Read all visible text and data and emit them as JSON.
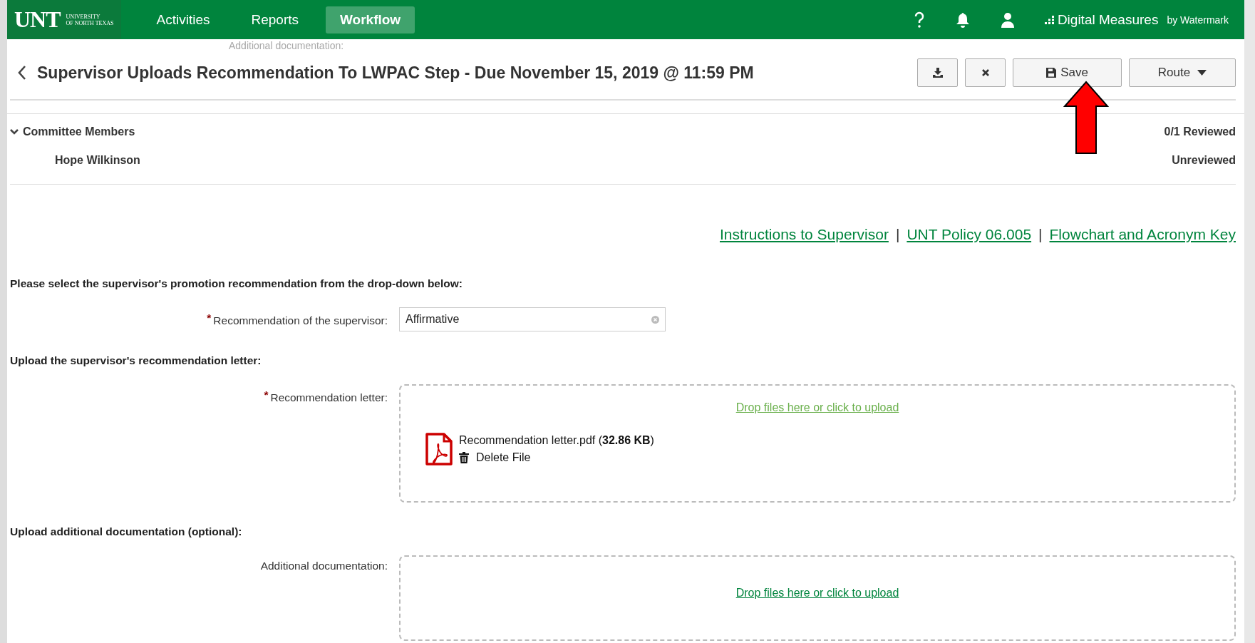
{
  "nav": {
    "brand": "UNT",
    "brand_sub": [
      "UNIVERSITY",
      "OF NORTH TEXAS"
    ],
    "tabs": [
      {
        "label": "Activities",
        "selected": false
      },
      {
        "label": "Reports",
        "selected": false
      },
      {
        "label": "Workflow",
        "selected": true
      }
    ],
    "product": "Digital Measures",
    "product_by": "by Watermark"
  },
  "ghost_label": "Additional documentation:",
  "title": "Supervisor Uploads Recommendation To LWPAC Step - Due November 15, 2019 @ 11:59 PM",
  "toolbar": {
    "save": "Save",
    "route": "Route"
  },
  "committee": {
    "heading": "Committee Members",
    "expanded": true,
    "summary": "0/1 Reviewed",
    "members": [
      {
        "name": "Hope Wilkinson",
        "status": "Unreviewed"
      }
    ]
  },
  "links": [
    {
      "label": "Instructions to Supervisor"
    },
    {
      "separator": "|",
      "label": "UNT Policy 06.005"
    },
    {
      "separator": "|",
      "label": "Flowchart and Acronym Key"
    }
  ],
  "sections": [
    {
      "kind": "select",
      "heading": "Please select the supervisor's promotion recommendation from the drop-down below:",
      "label": "Recommendation of the supervisor:",
      "required_mark": "*",
      "value": "Affirmative"
    },
    {
      "kind": "upload",
      "heading": "Upload the supervisor's recommendation letter:",
      "label": "Recommendation letter:",
      "required_mark": "*",
      "drop_text": "Drop files here or click to upload",
      "hovered": true,
      "files": [
        {
          "name": "Recommendation letter.pdf (**32.86 KB**)",
          "delete": "Delete File"
        }
      ]
    },
    {
      "kind": "upload",
      "heading": "Upload additional documentation (optional):",
      "label": "Additional documentation:",
      "drop_text": "Drop files here or click to upload",
      "hovered": false
    }
  ]
}
